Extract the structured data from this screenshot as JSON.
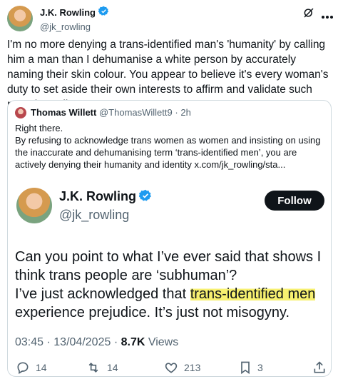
{
  "post": {
    "author_name": "J.K. Rowling",
    "author_handle": "@jk_rowling",
    "text": "I'm no more denying a trans-identified man's 'humanity' by calling him a man than I dehumanise a white person by accurately naming their skin colour. You appear to believe it's every woman's duty to set aside their own interests to affirm and validate such men, but I disagree."
  },
  "quote": {
    "author_name": "Thomas Willett",
    "author_handle": "@ThomasWillett9",
    "separator": "·",
    "time": "2h",
    "line1": "Right there.",
    "line2": "By refusing to acknowledge trans women as women and insisting on using the inaccurate and dehumanising term ‘trans-identified men’, you are actively denying their humanity and identity  x.com/jk_rowling/sta..."
  },
  "embedded": {
    "author_name": "J.K. Rowling",
    "author_handle": "@jk_rowling",
    "follow_label": "Follow",
    "text_line1": "Can you point to what I’ve ever said that shows I",
    "text_line2": "think trans people are ‘subhuman’?",
    "text_line3_before": "I’ve just acknowledged that ",
    "text_line3_highlight": "trans-identified men",
    "text_line4": "experience prejudice. It’s just not misogyny.",
    "time": "03:45",
    "date": "13/04/2025",
    "views_count": "8.7K",
    "views_label": "Views",
    "dot": "·",
    "actions": {
      "replies": "14",
      "reposts": "14",
      "likes": "213",
      "bookmarks": "3"
    }
  },
  "colors": {
    "highlight": "#f7f070",
    "verified": "#1d9bf0",
    "secondary_text": "#536471"
  },
  "icons": [
    "verified-icon",
    "grok-icon",
    "more-icon",
    "reply-icon",
    "repost-icon",
    "like-icon",
    "bookmark-icon",
    "share-icon"
  ]
}
